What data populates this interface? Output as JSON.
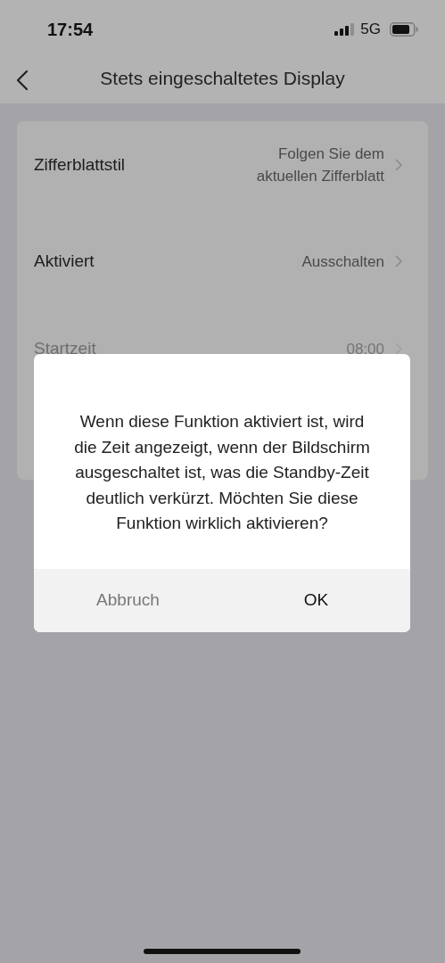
{
  "status_bar": {
    "time": "17:54",
    "network": "5G"
  },
  "nav": {
    "title": "Stets eingeschaltetes Display"
  },
  "settings": [
    {
      "label": "Zifferblattstil",
      "value": "Folgen Sie dem aktuellen Zifferblatt",
      "disabled": false
    },
    {
      "label": "Aktiviert",
      "value": "Ausschalten",
      "disabled": false
    },
    {
      "label": "Startzeit",
      "value": "08:00",
      "disabled": true
    }
  ],
  "dialog": {
    "message": "Wenn diese Funktion aktiviert ist, wird die Zeit angezeigt, wenn der Bildschirm ausgeschaltet ist, was die Standby-Zeit deutlich verkürzt. Möchten Sie diese Funktion wirklich aktivieren?",
    "buttons": [
      {
        "label": "Abbruch",
        "kind": "cancel"
      },
      {
        "label": "OK",
        "kind": "confirm"
      }
    ]
  }
}
